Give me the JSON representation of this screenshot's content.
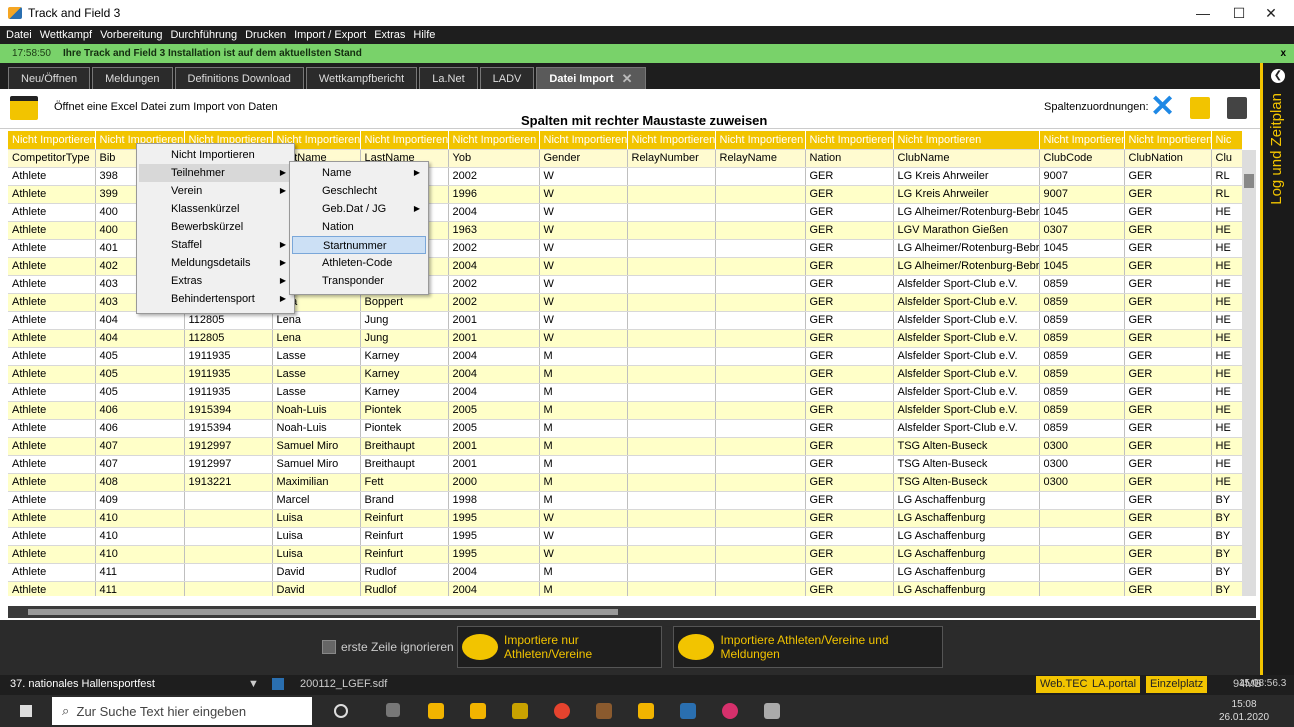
{
  "window": {
    "title": "Track and Field 3",
    "min": "—",
    "max": "☐",
    "close": "✕"
  },
  "menu": [
    "Datei",
    "Wettkampf",
    "Vorbereitung",
    "Durchführung",
    "Drucken",
    "Import / Export",
    "Extras",
    "Hilfe"
  ],
  "notification": {
    "time": "17:58:50",
    "message": "Ihre Track and Field 3 Installation ist auf dem aktuellsten Stand",
    "close": "x"
  },
  "tabs": [
    {
      "label": "Neu/Öffnen"
    },
    {
      "label": "Meldungen"
    },
    {
      "label": "Definitions Download"
    },
    {
      "label": "Wettkampfbericht"
    },
    {
      "label": "La.Net"
    },
    {
      "label": "LADV"
    },
    {
      "label": "Datei Import",
      "active": true
    }
  ],
  "tab_close": "✕",
  "side_panel": {
    "label": "Log und Zeitplan",
    "icon": "❮"
  },
  "toolbar": {
    "open_text": "Öffnet eine Excel Datei zum Import von Daten",
    "hint": "Spalten mit rechter Maustaste zuweisen",
    "mapping_label": "Spaltenzuordnungen:",
    "clear_icon": "✕"
  },
  "table": {
    "header": [
      "Nicht Importieren",
      "Nicht Importieren",
      "Nicht Importieren",
      "Nicht Importieren",
      "Nicht Importieren",
      "Nicht Importieren",
      "Nicht Importieren",
      "Nicht Importieren",
      "Nicht Importieren",
      "Nicht Importieren",
      "Nicht Importieren",
      "Nicht Importieren",
      "Nicht Importieren",
      "Nic"
    ],
    "columns": [
      "CompetitorType",
      "Bib",
      "",
      "LastName",
      "LastName",
      "Yob",
      "Gender",
      "RelayNumber",
      "RelayName",
      "Nation",
      "ClubName",
      "ClubCode",
      "ClubNation",
      "Clu"
    ],
    "rows": [
      [
        "Athlete",
        "398",
        "",
        "",
        "",
        "2002",
        "W",
        "",
        "",
        "GER",
        "LG Kreis Ahrweiler",
        "9007",
        "GER",
        "RL"
      ],
      [
        "Athlete",
        "399",
        "",
        "",
        "",
        "1996",
        "W",
        "",
        "",
        "GER",
        "LG Kreis Ahrweiler",
        "9007",
        "GER",
        "RL"
      ],
      [
        "Athlete",
        "400",
        "",
        "",
        "",
        "2004",
        "W",
        "",
        "",
        "GER",
        "LG Alheimer/Rotenburg-Bebra",
        "1045",
        "GER",
        "HE"
      ],
      [
        "Athlete",
        "400",
        "",
        "",
        "er",
        "1963",
        "W",
        "",
        "",
        "GER",
        "LGV Marathon Gießen",
        "0307",
        "GER",
        "HE"
      ],
      [
        "Athlete",
        "401",
        "",
        "",
        "",
        "2002",
        "W",
        "",
        "",
        "GER",
        "LG Alheimer/Rotenburg-Bebra",
        "1045",
        "GER",
        "HE"
      ],
      [
        "Athlete",
        "402",
        "",
        "",
        "",
        "2004",
        "W",
        "",
        "",
        "GER",
        "LG Alheimer/Rotenburg-Bebra",
        "1045",
        "GER",
        "HE"
      ],
      [
        "Athlete",
        "403",
        "",
        "",
        "",
        "2002",
        "W",
        "",
        "",
        "GER",
        "Alsfelder Sport-Club e.V.",
        "0859",
        "GER",
        "HE"
      ],
      [
        "Athlete",
        "403",
        "",
        "hina",
        "Boppert",
        "2002",
        "W",
        "",
        "",
        "GER",
        "Alsfelder Sport-Club e.V.",
        "0859",
        "GER",
        "HE"
      ],
      [
        "Athlete",
        "404",
        "112805",
        "Lena",
        "Jung",
        "2001",
        "W",
        "",
        "",
        "GER",
        "Alsfelder Sport-Club e.V.",
        "0859",
        "GER",
        "HE"
      ],
      [
        "Athlete",
        "404",
        "112805",
        "Lena",
        "Jung",
        "2001",
        "W",
        "",
        "",
        "GER",
        "Alsfelder Sport-Club e.V.",
        "0859",
        "GER",
        "HE"
      ],
      [
        "Athlete",
        "405",
        "1911935",
        "Lasse",
        "Karney",
        "2004",
        "M",
        "",
        "",
        "GER",
        "Alsfelder Sport-Club e.V.",
        "0859",
        "GER",
        "HE"
      ],
      [
        "Athlete",
        "405",
        "1911935",
        "Lasse",
        "Karney",
        "2004",
        "M",
        "",
        "",
        "GER",
        "Alsfelder Sport-Club e.V.",
        "0859",
        "GER",
        "HE"
      ],
      [
        "Athlete",
        "405",
        "1911935",
        "Lasse",
        "Karney",
        "2004",
        "M",
        "",
        "",
        "GER",
        "Alsfelder Sport-Club e.V.",
        "0859",
        "GER",
        "HE"
      ],
      [
        "Athlete",
        "406",
        "1915394",
        "Noah-Luis",
        "Piontek",
        "2005",
        "M",
        "",
        "",
        "GER",
        "Alsfelder Sport-Club e.V.",
        "0859",
        "GER",
        "HE"
      ],
      [
        "Athlete",
        "406",
        "1915394",
        "Noah-Luis",
        "Piontek",
        "2005",
        "M",
        "",
        "",
        "GER",
        "Alsfelder Sport-Club e.V.",
        "0859",
        "GER",
        "HE"
      ],
      [
        "Athlete",
        "407",
        "1912997",
        "Samuel Miro",
        "Breithaupt",
        "2001",
        "M",
        "",
        "",
        "GER",
        "TSG Alten-Buseck",
        "0300",
        "GER",
        "HE"
      ],
      [
        "Athlete",
        "407",
        "1912997",
        "Samuel Miro",
        "Breithaupt",
        "2001",
        "M",
        "",
        "",
        "GER",
        "TSG Alten-Buseck",
        "0300",
        "GER",
        "HE"
      ],
      [
        "Athlete",
        "408",
        "1913221",
        "Maximilian",
        "Fett",
        "2000",
        "M",
        "",
        "",
        "GER",
        "TSG Alten-Buseck",
        "0300",
        "GER",
        "HE"
      ],
      [
        "Athlete",
        "409",
        "",
        "Marcel",
        "Brand",
        "1998",
        "M",
        "",
        "",
        "GER",
        "LG Aschaffenburg",
        "",
        "GER",
        "BY"
      ],
      [
        "Athlete",
        "410",
        "",
        "Luisa",
        "Reinfurt",
        "1995",
        "W",
        "",
        "",
        "GER",
        "LG Aschaffenburg",
        "",
        "GER",
        "BY"
      ],
      [
        "Athlete",
        "410",
        "",
        "Luisa",
        "Reinfurt",
        "1995",
        "W",
        "",
        "",
        "GER",
        "LG Aschaffenburg",
        "",
        "GER",
        "BY"
      ],
      [
        "Athlete",
        "410",
        "",
        "Luisa",
        "Reinfurt",
        "1995",
        "W",
        "",
        "",
        "GER",
        "LG Aschaffenburg",
        "",
        "GER",
        "BY"
      ],
      [
        "Athlete",
        "411",
        "",
        "David",
        "Rudlof",
        "2004",
        "M",
        "",
        "",
        "GER",
        "LG Aschaffenburg",
        "",
        "GER",
        "BY"
      ],
      [
        "Athlete",
        "411",
        "",
        "David",
        "Rudlof",
        "2004",
        "M",
        "",
        "",
        "GER",
        "LG Aschaffenburg",
        "",
        "GER",
        "BY"
      ]
    ]
  },
  "context_menu": {
    "items": [
      {
        "label": "Nicht Importieren"
      },
      {
        "label": "Teilnehmer",
        "sub": true,
        "selected": true
      },
      {
        "label": "Verein",
        "sub": true
      },
      {
        "label": "Klassenkürzel"
      },
      {
        "label": "Bewerbskürzel"
      },
      {
        "label": "Staffel",
        "sub": true
      },
      {
        "label": "Meldungsdetails",
        "sub": true
      },
      {
        "label": "Extras",
        "sub": true
      },
      {
        "label": "Behindertensport",
        "sub": true
      }
    ]
  },
  "submenu": {
    "items": [
      {
        "label": "Name",
        "sub": true
      },
      {
        "label": "Geschlecht"
      },
      {
        "label": "Geb.Dat / JG",
        "sub": true
      },
      {
        "label": "Nation"
      },
      {
        "label": "Startnummer",
        "highlight": true
      },
      {
        "label": "Athleten-Code"
      },
      {
        "label": "Transponder"
      }
    ]
  },
  "submenu_arrow": "▶",
  "bottom": {
    "ignore_label": "erste Zeile ignorieren",
    "btn_athletes": "Importiere nur Athleten/Vereine",
    "btn_all": "Importiere Athleten/Vereine und Meldungen"
  },
  "status": {
    "event": "37. nationales Hallensportfest",
    "dropdown": "▼",
    "file": "200112_LGEF.sdf",
    "webtec": "Web.TEC",
    "laportal": "LA.portal",
    "einzelplatz": "Einzelplatz",
    "memory": "94MB",
    "clock": "15:08:56.3"
  },
  "taskbar": {
    "search_placeholder": "Zur Suche Text hier eingeben",
    "time": "15:08",
    "date": "26.01.2020"
  }
}
